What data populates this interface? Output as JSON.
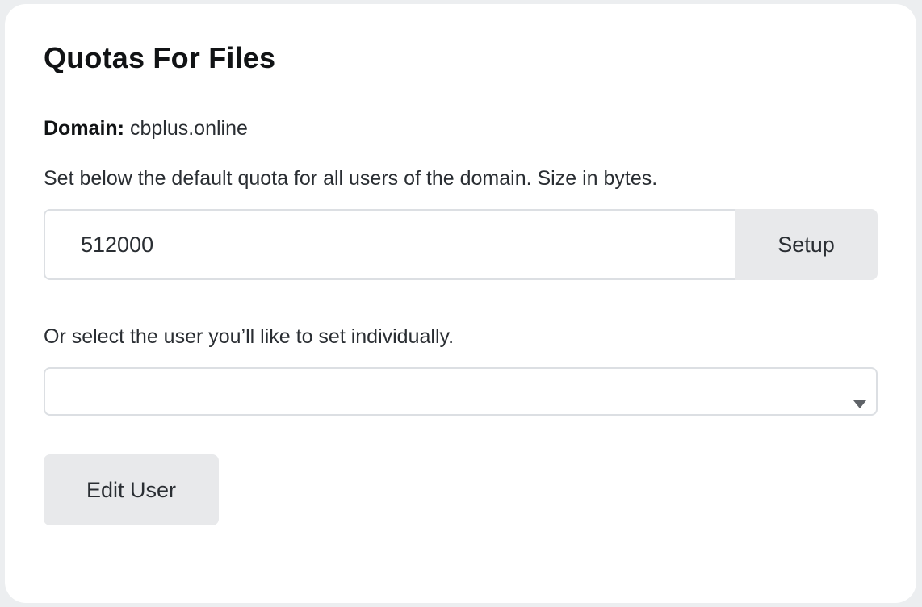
{
  "panel": {
    "title": "Quotas For Files",
    "domain_label": "Domain:",
    "domain_value": "cbplus.online",
    "default_quota_description": "Set below the default quota for all users of the domain. Size in bytes."
  },
  "quota_form": {
    "input_value": "512000",
    "setup_label": "Setup"
  },
  "user_form": {
    "select_description": "Or select the user you’ll like to set individually.",
    "selected_user": "",
    "edit_label": "Edit User"
  },
  "colors": {
    "page_background": "#eceef0",
    "card_background": "#ffffff",
    "button_background": "#e8e9eb",
    "border": "#dcdfe3"
  },
  "icons": {
    "select_caret": "chevron-down-icon"
  }
}
